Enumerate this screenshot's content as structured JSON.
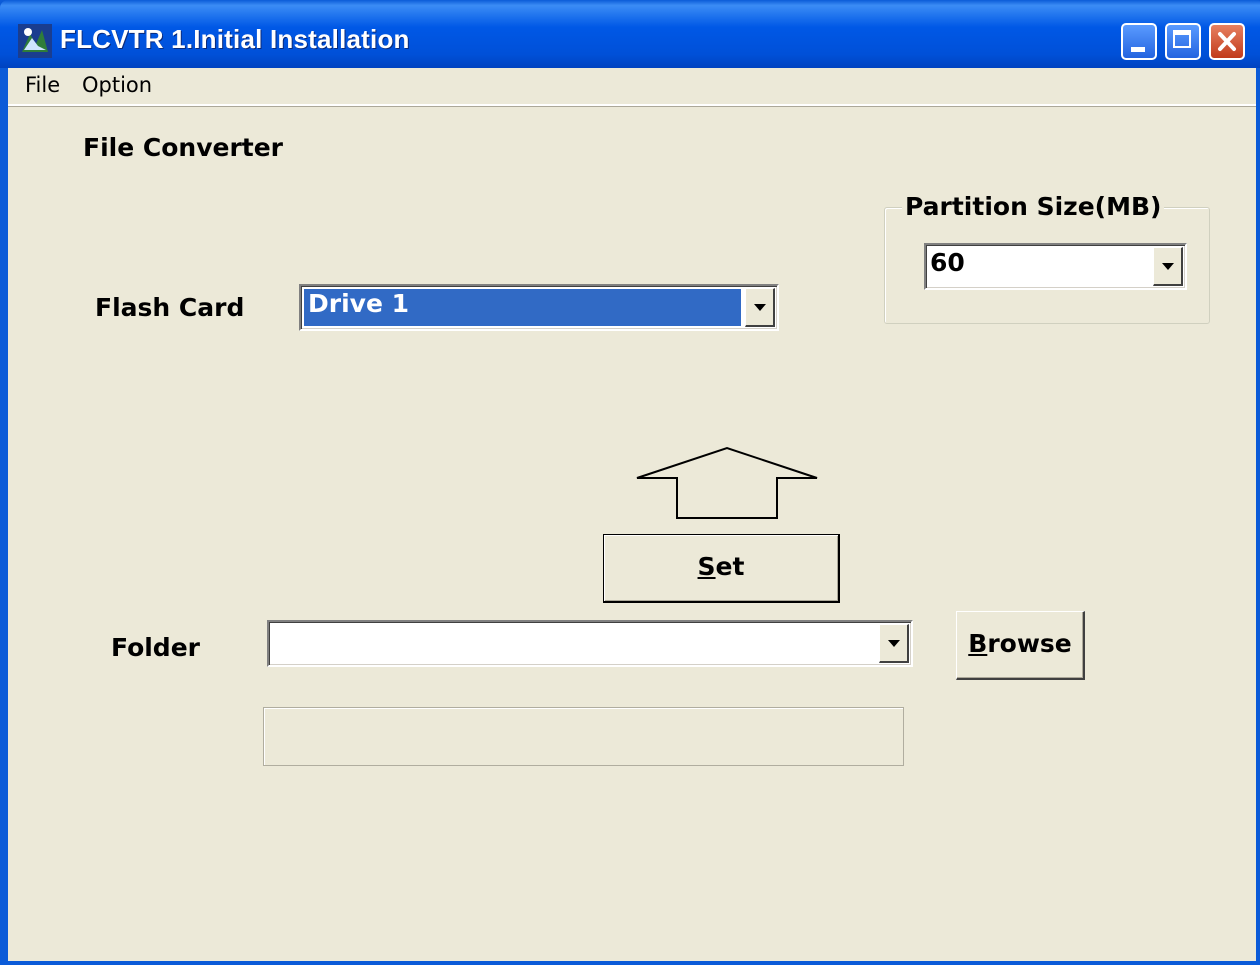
{
  "window": {
    "title": "FLCVTR  1.Initial Installation"
  },
  "menu": {
    "items": [
      "File",
      "Option"
    ]
  },
  "main": {
    "heading": "File Converter",
    "partition": {
      "label": "Partition Size(MB)",
      "value": "60"
    },
    "flash_card": {
      "label": "Flash Card",
      "value": "Drive 1"
    },
    "set_button": {
      "label_underlined": "S",
      "label_rest": "et"
    },
    "folder": {
      "label": "Folder",
      "value": ""
    },
    "browse_button": {
      "label_underlined": "B",
      "label_rest": "rowse"
    },
    "status": ""
  },
  "colors": {
    "titlebar": "#0058e6",
    "selection": "#316ac5",
    "face": "#ece9d8",
    "close": "#c13b1b"
  }
}
